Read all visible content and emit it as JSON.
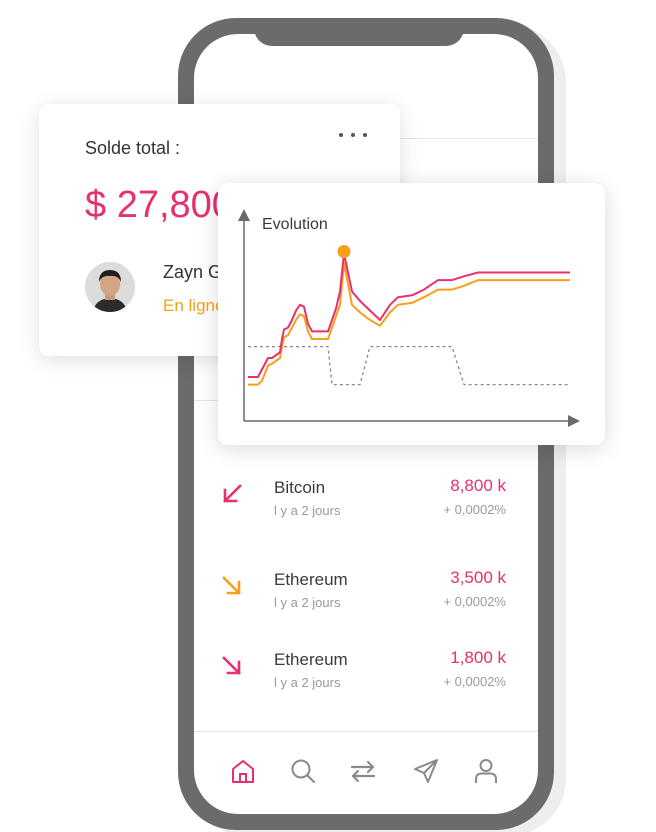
{
  "colors": {
    "pink": "#e8306e",
    "orange": "#f6a01a",
    "gray": "#6b6b6b"
  },
  "balance_card": {
    "label": "Solde total :",
    "value": "$ 27,800",
    "menu_icon": "more-horizontal-icon",
    "user": {
      "name": "Zayn G",
      "status": "En ligne"
    }
  },
  "chart_data": {
    "type": "line",
    "title": "Evolution",
    "xlabel": "",
    "ylabel": "",
    "x": [
      0,
      10,
      14,
      20,
      24,
      32,
      34,
      36,
      40,
      44,
      48,
      52,
      56,
      60,
      64,
      72,
      80,
      84,
      88,
      92,
      96,
      104,
      112,
      122,
      132,
      142,
      150,
      164,
      176,
      190,
      204,
      216,
      230,
      248,
      260,
      280,
      300,
      322
    ],
    "series": [
      {
        "color": "#e8306e",
        "values": [
          20,
          20,
          24,
          30,
          30,
          33,
          40,
          45,
          46,
          50,
          55,
          58,
          57,
          48,
          44,
          44,
          44,
          50,
          56,
          65,
          85,
          65,
          60,
          55,
          50,
          58,
          62,
          63,
          66,
          71,
          71,
          73,
          75,
          75,
          75,
          75,
          75,
          75
        ]
      },
      {
        "color": "#f6a01a",
        "values": [
          16,
          16,
          18,
          26,
          27,
          30,
          36,
          41,
          42,
          46,
          50,
          53,
          52,
          44,
          40,
          40,
          40,
          46,
          52,
          58,
          80,
          58,
          54,
          50,
          47,
          54,
          58,
          59,
          62,
          66,
          66,
          68,
          71,
          71,
          71,
          71,
          71,
          71
        ]
      },
      {
        "color": "#888888",
        "values": [
          36,
          36,
          36,
          36,
          36,
          36,
          36,
          36,
          36,
          36,
          36,
          36,
          36,
          36,
          36,
          36,
          36,
          16,
          16,
          16,
          16,
          16,
          16,
          36,
          36,
          36,
          36,
          36,
          36,
          36,
          36,
          16,
          16,
          16,
          16,
          16,
          16,
          16
        ]
      }
    ],
    "peak_marker": {
      "series": 0,
      "index": 20
    },
    "ylim": [
      0,
      100
    ],
    "grid": false
  },
  "transactions": [
    {
      "name": "Bitcoin",
      "time": "l y a 2 jours",
      "amount": "8,800 k",
      "change": "+ 0,0002%",
      "color": "#e8306e",
      "direction": "down-left"
    },
    {
      "name": "Ethereum",
      "time": "l y a 2 jours",
      "amount": "3,500 k",
      "change": "+ 0,0002%",
      "color": "#f6a01a",
      "direction": "down-right"
    },
    {
      "name": "Ethereum",
      "time": "l y a 2 jours",
      "amount": "1,800 k",
      "change": "+ 0,0002%",
      "color": "#e8306e",
      "direction": "down-right"
    }
  ],
  "nav": [
    {
      "icon": "home-icon",
      "active": true
    },
    {
      "icon": "search-icon",
      "active": false
    },
    {
      "icon": "transfer-icon",
      "active": false
    },
    {
      "icon": "send-icon",
      "active": false
    },
    {
      "icon": "profile-icon",
      "active": false
    }
  ]
}
